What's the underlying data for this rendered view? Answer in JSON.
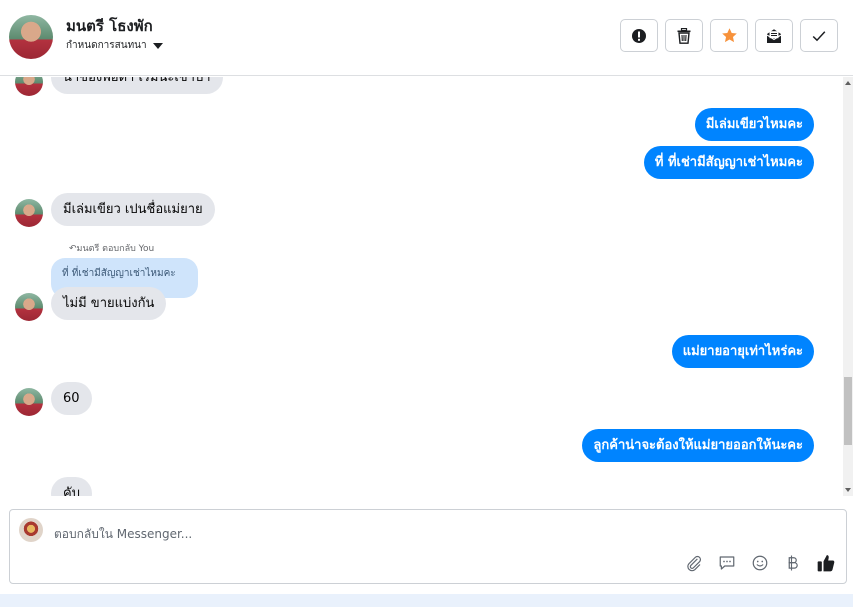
{
  "header": {
    "contact_name": "มนตรี โธงพัก",
    "subtitle": "กำหนดการสนทนา"
  },
  "messages": {
    "m0": "น้าของพ่อตา เริ่มนะเข้าปา",
    "m1": "มีเล่มเขียวไหมคะ",
    "m2": "ที่ ที่เช่ามีสัญญาเช่าไหมคะ",
    "m3": "มีเล่มเขียว เปนชื่อแม่ยาย",
    "reply_note": "มนตรี ตอบกลับ You",
    "quoted": "ที่ ที่เช่ามีสัญญาเช่าไหมคะ",
    "m4": "ไม่มี ขายแบ่งกัน",
    "m5": "แม่ยายอายุเท่าไหร่คะ",
    "m6": "60",
    "m7": "ลูกค้าน่าจะต้องให้แม่ยายออกให้นะคะ",
    "m8": "คับ"
  },
  "composer": {
    "placeholder": "ตอบกลับใน Messenger..."
  },
  "colors": {
    "outgoing": "#0084ff",
    "incoming": "#e4e6eb",
    "star": "#f7923b"
  },
  "icons": [
    "alert-icon",
    "trash-icon",
    "star-icon",
    "mark-unread-icon",
    "check-icon",
    "attach-icon",
    "saved-reply-icon",
    "emoji-icon",
    "baht-icon",
    "like-icon"
  ]
}
